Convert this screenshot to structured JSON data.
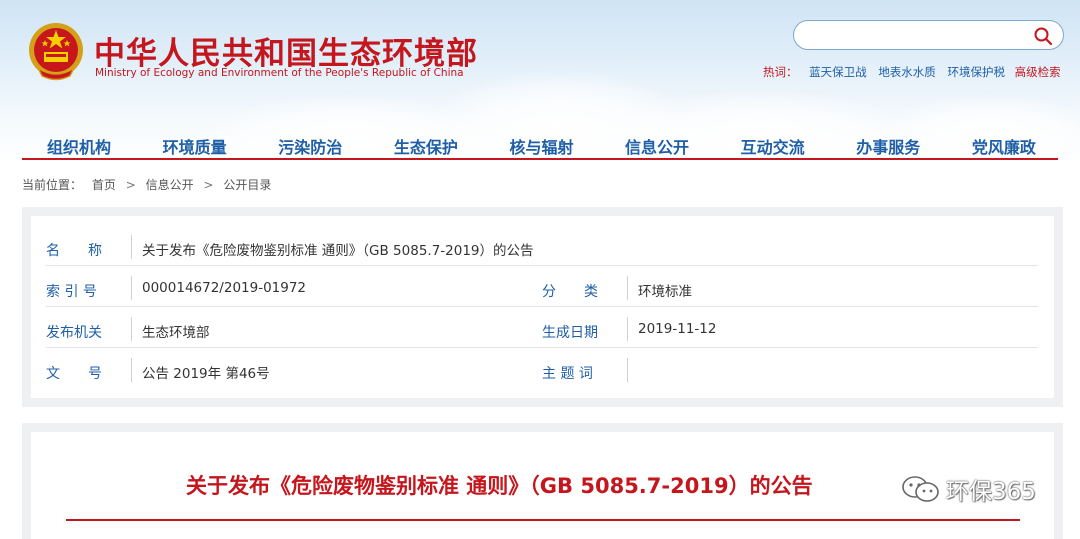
{
  "header": {
    "title": "中华人民共和国生态环境部",
    "subtitle": "Ministry of Ecology and Environment of the People's Republic of China",
    "search": {
      "value": "",
      "placeholder": ""
    },
    "hot_label": "热词：",
    "hot_words": [
      "蓝天保卫战",
      "地表水水质",
      "环境保护税"
    ],
    "advanced_search": "高级检索"
  },
  "nav": {
    "items": [
      "组织机构",
      "环境质量",
      "污染防治",
      "生态保护",
      "核与辐射",
      "信息公开",
      "互动交流",
      "办事服务",
      "党风廉政"
    ]
  },
  "breadcrumb": {
    "label": "当前位置：",
    "items": [
      "首页",
      "信息公开",
      "公开目录"
    ],
    "separator": ">"
  },
  "info": {
    "name": {
      "label": "名　　称",
      "value": "关于发布《危险废物鉴别标准 通则》（GB 5085.7-2019）的公告"
    },
    "index": {
      "label": "索 引 号",
      "value": "000014672/2019-01972"
    },
    "category": {
      "label": "分　　类",
      "value": "环境标准"
    },
    "publisher": {
      "label": "发布机关",
      "value": "生态环境部"
    },
    "date": {
      "label": "生成日期",
      "value": "2019-11-12"
    },
    "doc_no": {
      "label": "文　　号",
      "value": "公告 2019年 第46号"
    },
    "subject": {
      "label": "主 题 词",
      "value": ""
    }
  },
  "content": {
    "title": "关于发布《危险废物鉴别标准 通则》（GB 5085.7-2019）的公告"
  },
  "watermark": {
    "text": "环保365"
  },
  "colors": {
    "brand_red": "#c4161c",
    "link_blue": "#1f5fa8"
  }
}
